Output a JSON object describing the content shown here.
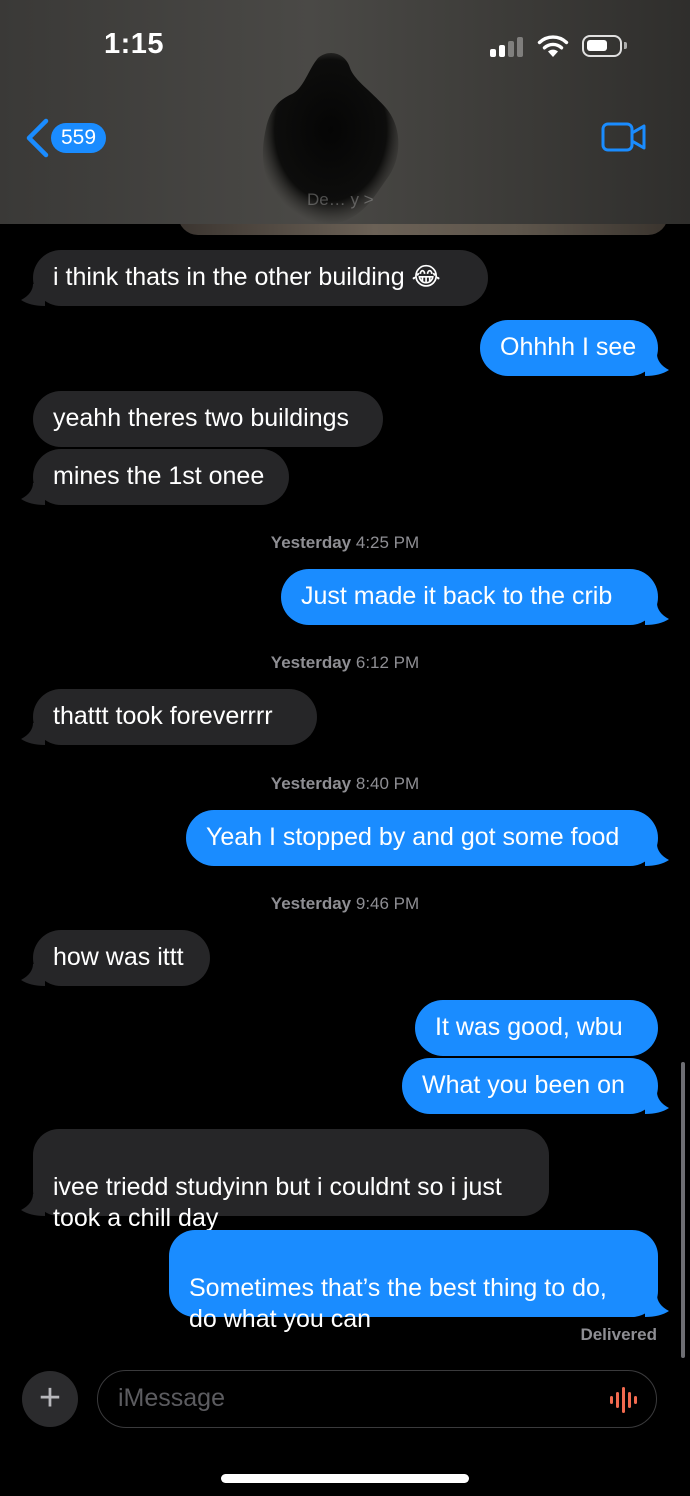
{
  "status_bar": {
    "time": "1:15"
  },
  "header": {
    "back_count": "559",
    "contact_name": "De… y >"
  },
  "messages": [
    {
      "direction": "in",
      "text": "i think thats in the other building 😂"
    },
    {
      "direction": "out",
      "text": "Ohhhh I see"
    },
    {
      "direction": "in",
      "text": "yeahh theres two buildings"
    },
    {
      "direction": "in",
      "text": "mines the 1st onee"
    },
    {
      "direction": "out",
      "text": "Just made it back to the crib"
    },
    {
      "direction": "in",
      "text": "thattt took foreverrrr"
    },
    {
      "direction": "out",
      "text": "Yeah I stopped by and got some food"
    },
    {
      "direction": "in",
      "text": "how was ittt"
    },
    {
      "direction": "out",
      "text": "It was good, wbu"
    },
    {
      "direction": "out",
      "text": "What you been on"
    },
    {
      "direction": "in",
      "text": "ivee triedd studyinn but i couldnt so i just\ntook a chill day"
    },
    {
      "direction": "out",
      "text": "Sometimes that’s the best thing to do,\ndo what you can"
    }
  ],
  "timestamps": [
    {
      "day": "Yesterday",
      "time": "4:25 PM"
    },
    {
      "day": "Yesterday",
      "time": "6:12 PM"
    },
    {
      "day": "Yesterday",
      "time": "8:40 PM"
    },
    {
      "day": "Yesterday",
      "time": "9:46 PM"
    }
  ],
  "delivery_status": "Delivered",
  "composer": {
    "placeholder": "iMessage"
  },
  "colors": {
    "accent": "#1a8cff",
    "incoming_bubble": "#262628",
    "background": "#000000",
    "timestamp": "#8e8e93"
  },
  "icons": [
    "back-chevron-icon",
    "video-camera-icon",
    "plus-icon",
    "audio-waveform-icon",
    "signal-icon",
    "wifi-icon",
    "battery-icon"
  ]
}
